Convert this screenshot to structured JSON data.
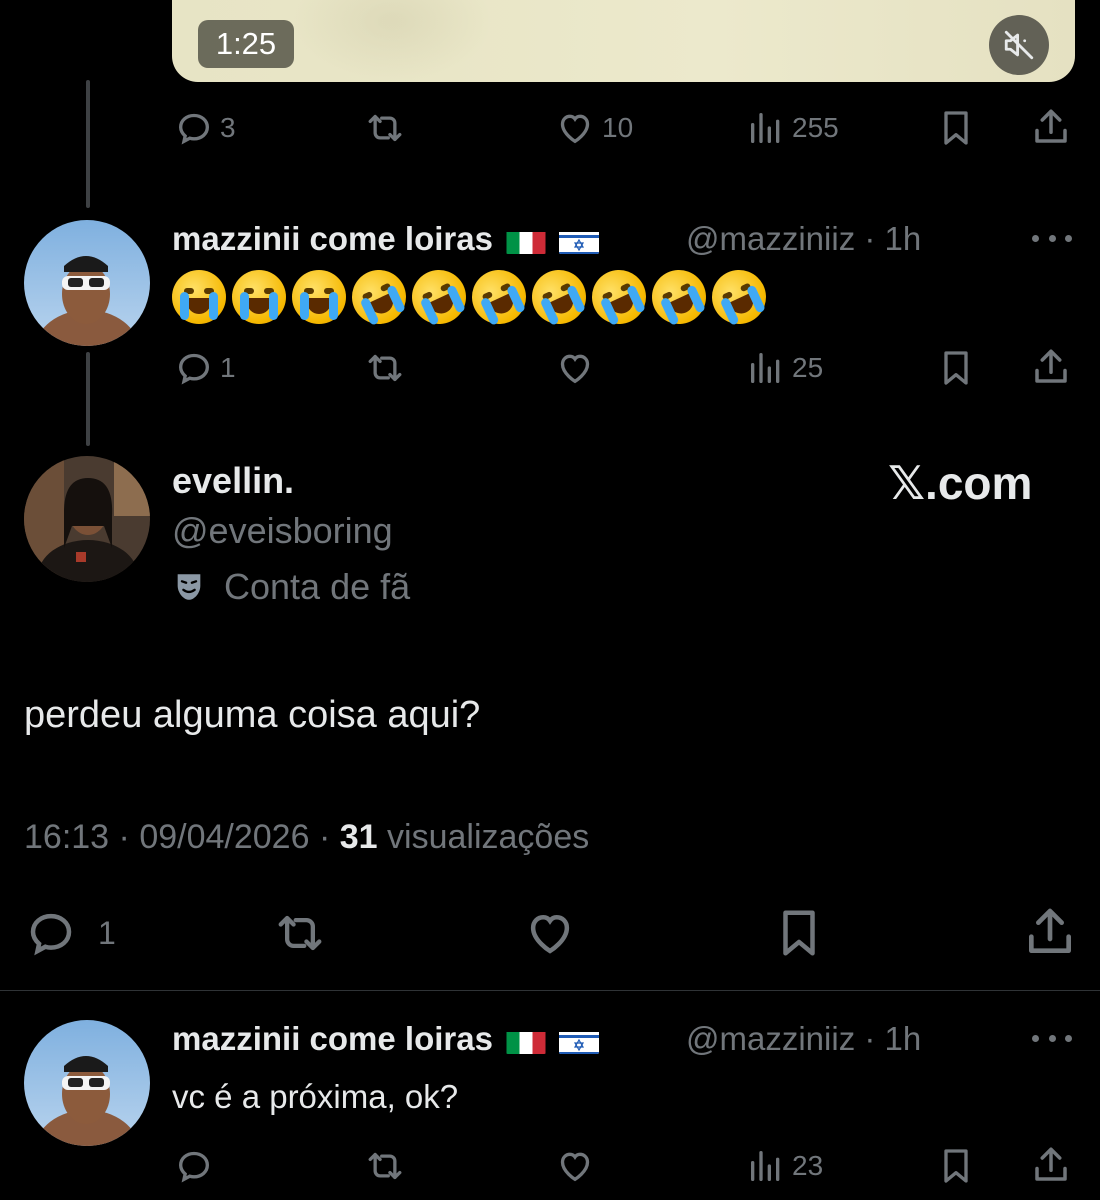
{
  "video": {
    "duration": "1:25",
    "mute_icon": "speaker-muted-icon"
  },
  "tweet_video_actions": {
    "replies": "3",
    "retweets": "",
    "likes": "10",
    "views": "255"
  },
  "reply1": {
    "display_name": "mazzinii come loiras",
    "flags": [
      "italy-flag",
      "israel-flag"
    ],
    "handle": "@mazziniiz",
    "separator": "·",
    "time": "1h",
    "emojis": [
      "loudly-crying-face",
      "loudly-crying-face",
      "loudly-crying-face",
      "rofl",
      "rofl",
      "rofl",
      "rofl",
      "rofl",
      "rofl",
      "rofl"
    ],
    "actions": {
      "replies": "1",
      "retweets": "",
      "likes": "",
      "views": "25"
    }
  },
  "main_tweet": {
    "display_name": "evellin.",
    "handle": "@eveisboring",
    "label": "Conta de fã",
    "brand": "𝕏.com",
    "text": "perdeu alguma coisa aqui?",
    "time": "16:13",
    "date": "09/04/2026",
    "separator": "·",
    "views_count": "31",
    "views_label": "visualizações",
    "actions": {
      "replies": "1"
    }
  },
  "reply2": {
    "display_name": "mazzinii come loiras",
    "flags": [
      "italy-flag",
      "israel-flag"
    ],
    "handle": "@mazziniiz",
    "separator": "·",
    "time": "1h",
    "text": "vc é a próxima, ok?",
    "actions": {
      "replies": "",
      "retweets": "",
      "likes": "",
      "views": "23"
    }
  },
  "colors": {
    "background": "#000000",
    "text_primary": "#e7e9ea",
    "text_secondary": "#71767b",
    "divider": "#2f3336",
    "thread_line": "#3e4144"
  }
}
